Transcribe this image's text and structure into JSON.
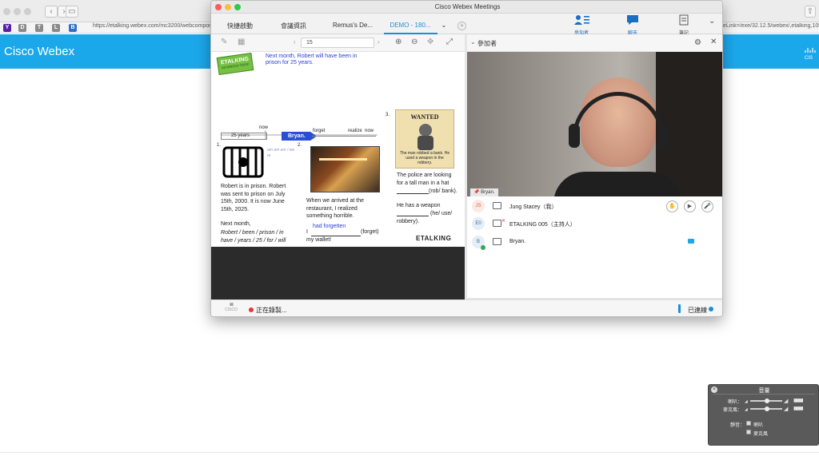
{
  "browser": {
    "url": "https://etalking.webex.com/mc3200/webcomponents/...",
    "url_right": "eLink=/exe/32.12.5/webex/,etalking,10918",
    "bookmarks": [
      "Y",
      "D",
      "T",
      "L",
      "B"
    ],
    "nav": {
      "back": "‹",
      "forward": "›"
    }
  },
  "page": {
    "title": "Cisco Webex"
  },
  "window": {
    "title": "Cisco Webex Meetings",
    "tabs": [
      "快捷啟動",
      "會議資訊",
      "Remus's De...",
      "DEMO - 180..."
    ],
    "active_tab": "DEMO - 180...",
    "right_buttons": [
      {
        "label": "參加者",
        "icon": "participants-icon"
      },
      {
        "label": "聊天",
        "icon": "chat-icon"
      },
      {
        "label": "筆記",
        "icon": "notes-icon"
      }
    ]
  },
  "share_toolbar": {
    "page_number": "15"
  },
  "slide": {
    "badge": "ETALKING",
    "badge_sub": "ADVANCED TOPIC",
    "intro": "Next month, Robert will have been in prison for 25 years.",
    "timeline_left": "25 years",
    "timeline_now": "now",
    "timeline_forget": "forget",
    "timeline_realize": "realize",
    "timeline_now2": "now",
    "timeline_arrow": "Bryan.",
    "s1_num": "1.",
    "s1_handwriting": "am am am / we re",
    "s1_text": "Robert is in prison. Robert was sent to prison on July 15th, 2000. It is now June 15th, 2025.",
    "s1_next": "Next month,",
    "s1_prompt": "Robert / been / prison / in have / years / 25 / for / will",
    "s2_num": "2.",
    "s2_text": "When we arrived at the restaurant, I realized something horrible.",
    "s2_answer": "had forgetten",
    "s2_blank_pre": "I",
    "s2_blank_post": "(forget) my wallet!",
    "s3_num": "3.",
    "wanted": "WANTED",
    "wanted_caption": "The man robbed a bank. He used a weapon in the robbery.",
    "s3_text1": "The police are looking for a tall man in a hat",
    "s3_blank1": "(rob/ bank).",
    "s3_text2": "He has a weapon",
    "s3_blank2": "(he/ use/ robbery).",
    "logo": "ETALKING"
  },
  "panel": {
    "title": "參加者",
    "video_name": "Bryan.",
    "participants": [
      {
        "initials": "JS",
        "name": "Jung Stacey（我）"
      },
      {
        "initials": "E0",
        "name": "ETALKING 005（主持人）"
      },
      {
        "initials": "B",
        "name": "Bryan."
      }
    ]
  },
  "status": {
    "cisco": "CISCO",
    "recording": "正在錄製...",
    "connected": "已連線"
  },
  "volume": {
    "title": "音量",
    "speaker": "喇叭：",
    "microphone": "麥克風：",
    "mute": "靜音：",
    "mute_speaker": "喇叭",
    "mute_mic": "麥克風",
    "levels": {
      "speaker": 0.5,
      "microphone": 0.5
    }
  }
}
